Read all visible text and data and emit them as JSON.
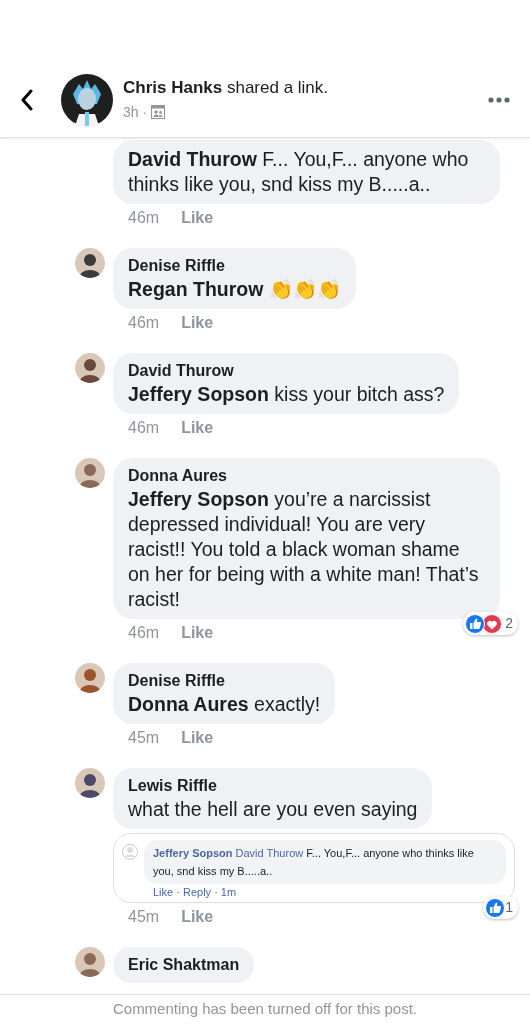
{
  "header": {
    "author": "Chris Hanks",
    "action": "shared a link.",
    "time": "3h ·"
  },
  "comments": [
    {
      "mentioned": "David Thurow",
      "text": "F... You,F... anyone who thinks like you, snd kiss my B.....a..",
      "time": "46m",
      "like": "Like"
    },
    {
      "author": "Denise Riffle",
      "mentioned": "Regan Thurow",
      "text": "👏👏👏",
      "time": "46m",
      "like": "Like"
    },
    {
      "author": "David Thurow",
      "mentioned": "Jeffery Sopson",
      "text": "kiss your bitch ass?",
      "time": "46m",
      "like": "Like"
    },
    {
      "author": "Donna Aures",
      "mentioned": "Jeffery Sopson",
      "text": "you’re a narcissist depressed individual! You are very racist!! You told a black woman shame on her for being with a white man! That’s racist!",
      "time": "46m",
      "like": "Like",
      "reactions": {
        "icons": [
          {
            "kind": "like"
          },
          {
            "kind": "love"
          }
        ],
        "count": "2"
      }
    },
    {
      "author": "Denise Riffle",
      "mentioned": "Donna Aures",
      "text": "exactly!",
      "time": "45m",
      "like": "Like"
    },
    {
      "author": "Lewis Riffle",
      "text": "what the hell are you even saying",
      "time": "45m",
      "like": "Like",
      "reactions": {
        "icons": [
          {
            "kind": "like"
          }
        ],
        "count": "1"
      },
      "attachment": {
        "author": "Jeffery Sopson",
        "mentioned": "David Thurow",
        "text": "F... You,F... anyone who thinks like you, snd kiss my B.....a..",
        "meta": "Like · Reply · 1m"
      }
    },
    {
      "author": "Eric Shaktman"
    }
  ],
  "footer": {
    "notice": "Commenting has been turned off for this post."
  }
}
